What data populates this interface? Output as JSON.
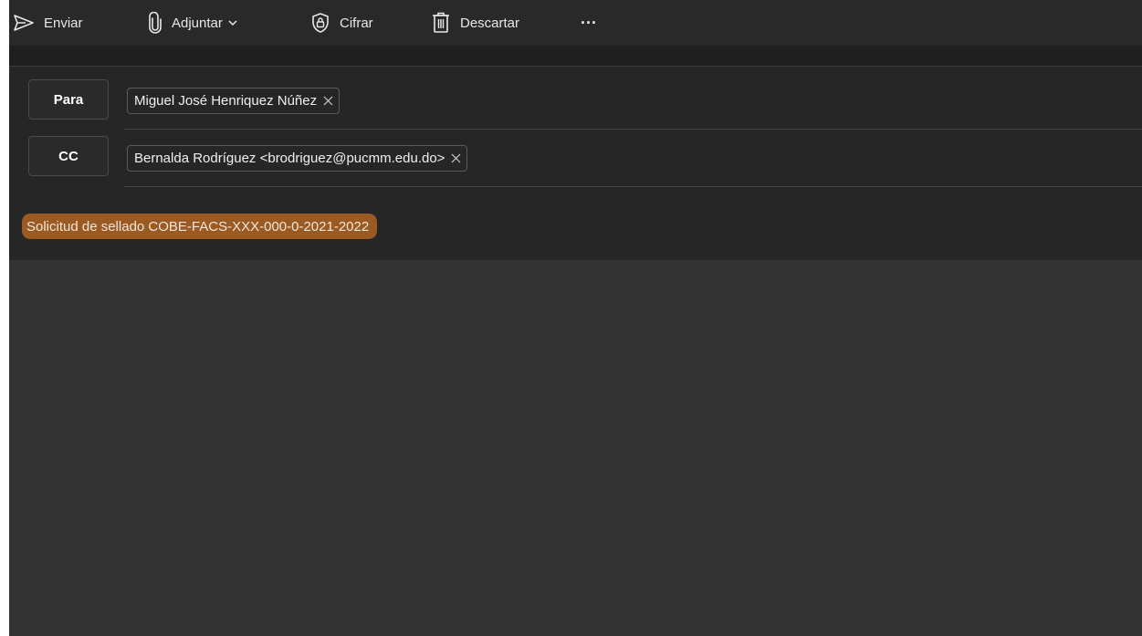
{
  "toolbar": {
    "send_label": "Enviar",
    "attach_label": "Adjuntar",
    "encrypt_label": "Cifrar",
    "discard_label": "Descartar",
    "more_label": "···"
  },
  "recipients": {
    "to_button": "Para",
    "to_chip": "Miguel José Henriquez Núñez",
    "cc_button": "CC",
    "cc_chip": "Bernalda Rodríguez <brodriguez@pucmm.edu.do>"
  },
  "subject": {
    "value": "Solicitud de sellado COBE-FACS-XXX-000-0-2021-2022"
  },
  "colors": {
    "background": "#1f1f1f",
    "subject_highlight": "#9a5a22",
    "body": "#333333"
  },
  "icons": {
    "send": "send-icon",
    "attach": "paperclip-icon",
    "encrypt": "shield-lock-icon",
    "discard": "trash-icon",
    "remove": "close-icon"
  }
}
